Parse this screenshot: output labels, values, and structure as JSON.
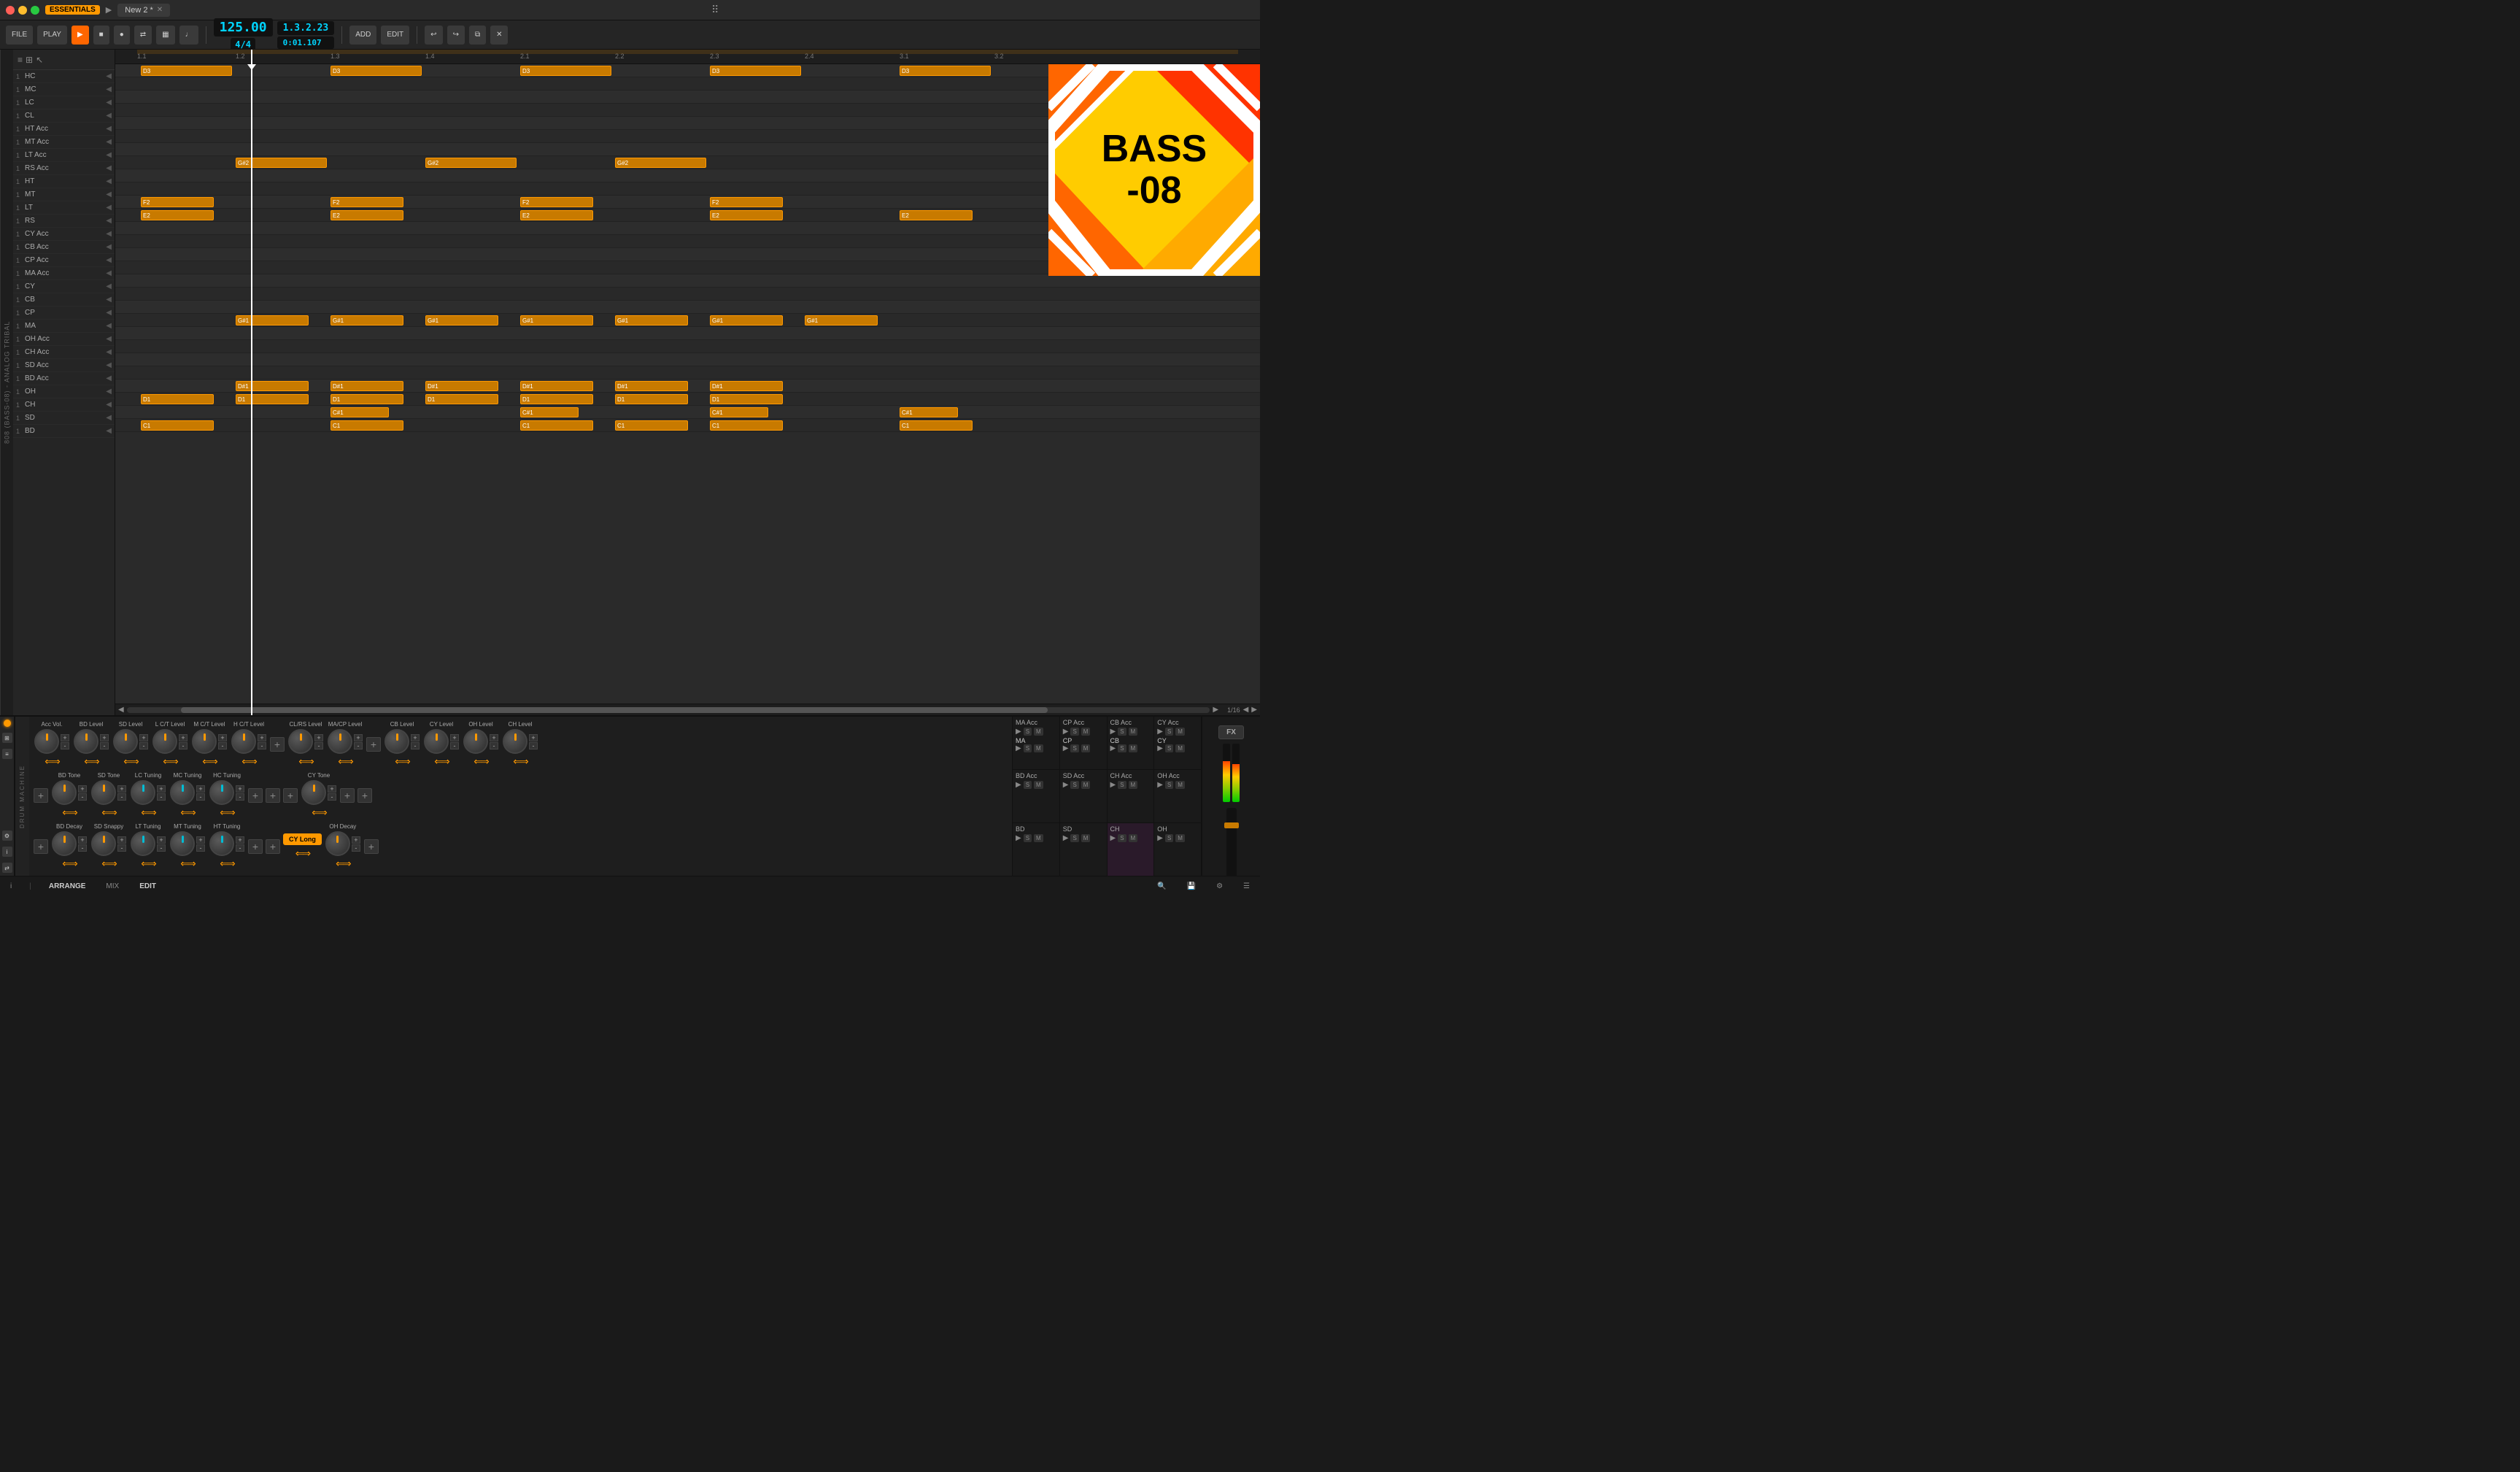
{
  "titleBar": {
    "appName": "ESSENTIALS",
    "tabName": "New 2 *",
    "centerIcon": "grid-dots"
  },
  "toolbar": {
    "fileLabel": "FILE",
    "playLabel": "PLAY",
    "tempoValue": "125.00",
    "timeSig": "4/4",
    "position": "1.3.2.23",
    "timeDisplay": "0:01.107",
    "addLabel": "ADD",
    "editLabel": "EDIT"
  },
  "tracks": [
    {
      "num": "1",
      "name": "HC"
    },
    {
      "num": "1",
      "name": "MC"
    },
    {
      "num": "1",
      "name": "LC"
    },
    {
      "num": "1",
      "name": "CL"
    },
    {
      "num": "1",
      "name": "HT Acc"
    },
    {
      "num": "1",
      "name": "MT Acc"
    },
    {
      "num": "1",
      "name": "LT Acc"
    },
    {
      "num": "1",
      "name": "RS Acc"
    },
    {
      "num": "1",
      "name": "HT"
    },
    {
      "num": "1",
      "name": "MT"
    },
    {
      "num": "1",
      "name": "LT"
    },
    {
      "num": "1",
      "name": "RS"
    },
    {
      "num": "1",
      "name": "CY Acc"
    },
    {
      "num": "1",
      "name": "CB Acc"
    },
    {
      "num": "1",
      "name": "CP Acc"
    },
    {
      "num": "1",
      "name": "MA Acc"
    },
    {
      "num": "1",
      "name": "CY"
    },
    {
      "num": "1",
      "name": "CB"
    },
    {
      "num": "1",
      "name": "CP"
    },
    {
      "num": "1",
      "name": "MA"
    },
    {
      "num": "1",
      "name": "OH Acc"
    },
    {
      "num": "1",
      "name": "CH Acc"
    },
    {
      "num": "1",
      "name": "SD Acc"
    },
    {
      "num": "1",
      "name": "BD Acc"
    },
    {
      "num": "1",
      "name": "OH"
    },
    {
      "num": "1",
      "name": "CH"
    },
    {
      "num": "1",
      "name": "SD"
    },
    {
      "num": "1",
      "name": "BD"
    }
  ],
  "rulerMarks": [
    "1.1",
    "1.2",
    "1.3",
    "1.4",
    "2.1",
    "2.2",
    "2.3",
    "2.4",
    "3.1",
    "3.2"
  ],
  "albumArt": {
    "title": "BASS\n-08"
  },
  "drumMachine": {
    "knobs": {
      "row1": [
        {
          "label": "Acc Vol.",
          "type": "orange"
        },
        {
          "label": "BD Level",
          "type": "orange"
        },
        {
          "label": "SD Level",
          "type": "orange"
        },
        {
          "label": "L C/T Level",
          "type": "orange"
        },
        {
          "label": "M C/T Level",
          "type": "orange"
        },
        {
          "label": "H C/T Level",
          "type": "orange"
        },
        {
          "label": "CL/RS Level",
          "type": "orange"
        },
        {
          "label": "MA/CP Level",
          "type": "orange"
        },
        {
          "label": "CB Level",
          "type": "orange"
        },
        {
          "label": "CY Level",
          "type": "orange"
        },
        {
          "label": "OH Level",
          "type": "orange"
        },
        {
          "label": "CH Level",
          "type": "orange"
        }
      ],
      "row2": [
        {
          "label": "BD Tone",
          "type": "orange"
        },
        {
          "label": "SD Tone",
          "type": "orange"
        },
        {
          "label": "LC Tuning",
          "type": "teal"
        },
        {
          "label": "MC Tuning",
          "type": "teal"
        },
        {
          "label": "HC Tuning",
          "type": "teal"
        },
        {
          "label": "CY Tone",
          "type": "orange"
        }
      ],
      "row3": [
        {
          "label": "BD Decay",
          "type": "orange"
        },
        {
          "label": "SD Snappy",
          "type": "orange"
        },
        {
          "label": "LT Tuning",
          "type": "teal"
        },
        {
          "label": "MT Tuning",
          "type": "teal"
        },
        {
          "label": "HT Tuning",
          "type": "teal"
        },
        {
          "label": "OH Decay",
          "type": "orange"
        }
      ]
    },
    "cyLongBtn": "CY Long",
    "channelStrips": [
      {
        "label": "MA Acc",
        "name": "MA"
      },
      {
        "label": "CP Acc",
        "name": "CP"
      },
      {
        "label": "CB Acc",
        "name": "CB"
      },
      {
        "label": "CY Acc",
        "name": "CY"
      },
      {
        "label": "BD Acc",
        "name": "BD"
      },
      {
        "label": "SD Acc",
        "name": "SD"
      },
      {
        "label": "CH Acc",
        "name": "CH"
      },
      {
        "label": "OH Acc",
        "name": "OH"
      },
      {
        "label": "BD",
        "name": "BD"
      },
      {
        "label": "SD",
        "name": "SD"
      },
      {
        "label": "CH",
        "name": "CH"
      },
      {
        "label": "OH",
        "name": "OH"
      }
    ]
  },
  "statusBar": {
    "infoLabel": "i",
    "arrangeLabel": "ARRANGE",
    "mixLabel": "MIX",
    "editLabel": "EDIT",
    "searchIcon": "search",
    "saveIcon": "save"
  },
  "colors": {
    "accent": "#ff9900",
    "accentDark": "#c87a00",
    "teal": "#00bcd4",
    "bg": "#1e1e1e",
    "bgLight": "#2a2a2a",
    "text": "#cccccc"
  }
}
